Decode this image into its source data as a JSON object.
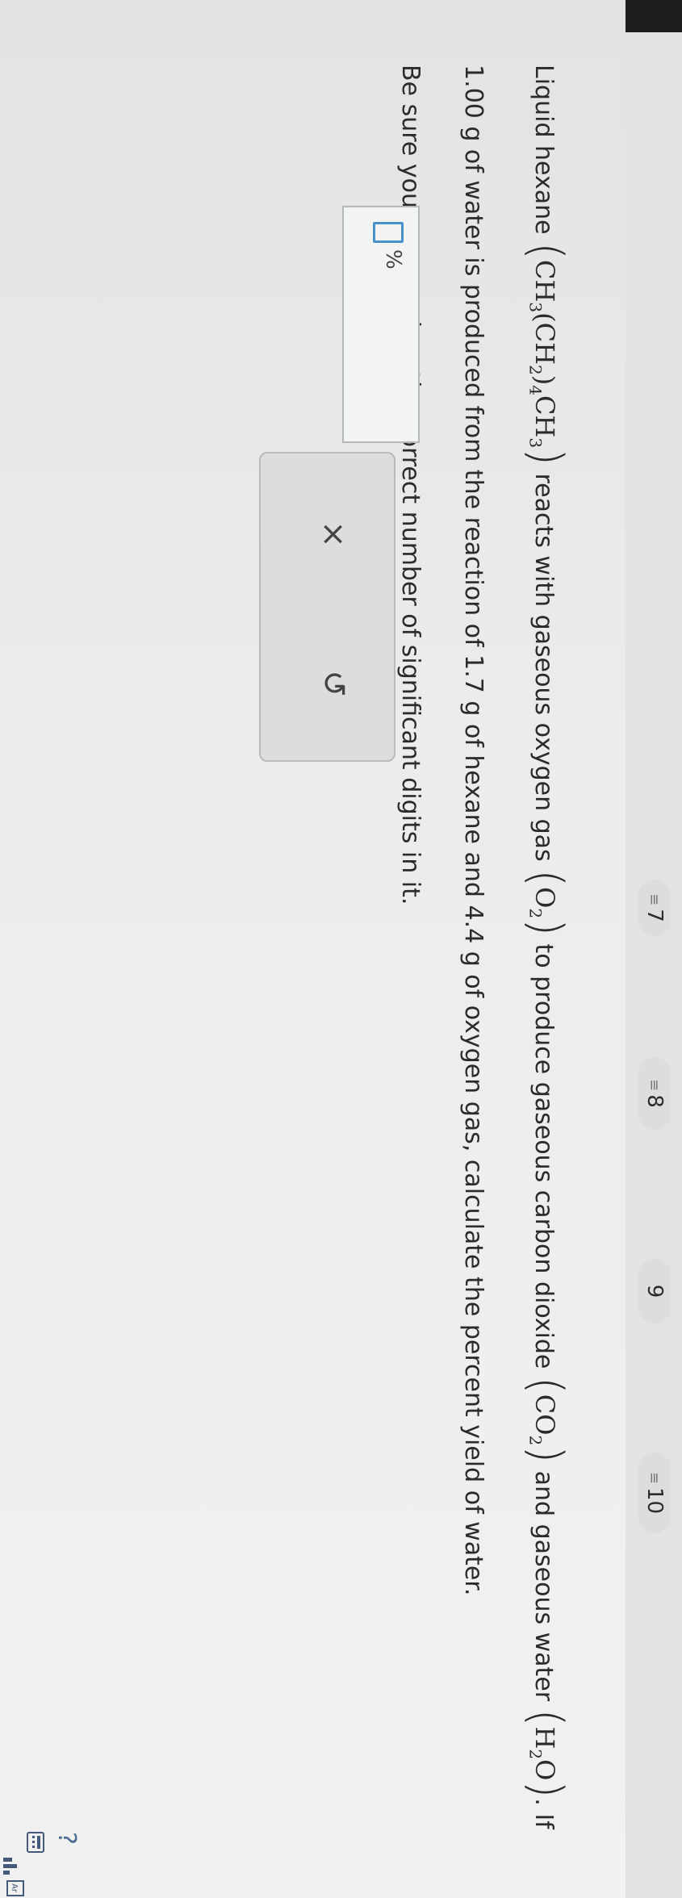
{
  "progress": {
    "steps": [
      {
        "label": "7",
        "has_lines": true
      },
      {
        "label": "8",
        "has_lines": true
      },
      {
        "label": "9",
        "has_lines": false
      },
      {
        "label": "10",
        "has_lines": true
      }
    ]
  },
  "question": {
    "intro": "Liquid hexane",
    "hexane_formula": "CH3(CH2)4CH3",
    "part1": "reacts with gaseous oxygen gas",
    "oxygen_formula": "O2",
    "part2": "to produce gaseous carbon dioxide",
    "co2_formula": "CO2",
    "part3": "and gaseous water",
    "water_formula": "H2O",
    "part4": ". If",
    "line2": "1.00 g of water is produced from the reaction of 1.7 g of hexane and 4.4 g of oxygen gas, calculate the percent yield of water.",
    "line3": "Be sure your answer has the correct number of significant digits in it."
  },
  "answer": {
    "value": "",
    "unit": "%"
  },
  "actions": {
    "clear_symbol": "×",
    "undo_symbol": "↺"
  },
  "side_tools": {
    "help": "?",
    "calculator": "calculator-icon",
    "chart": "chart-icon",
    "periodic": "periodic-table-icon"
  }
}
